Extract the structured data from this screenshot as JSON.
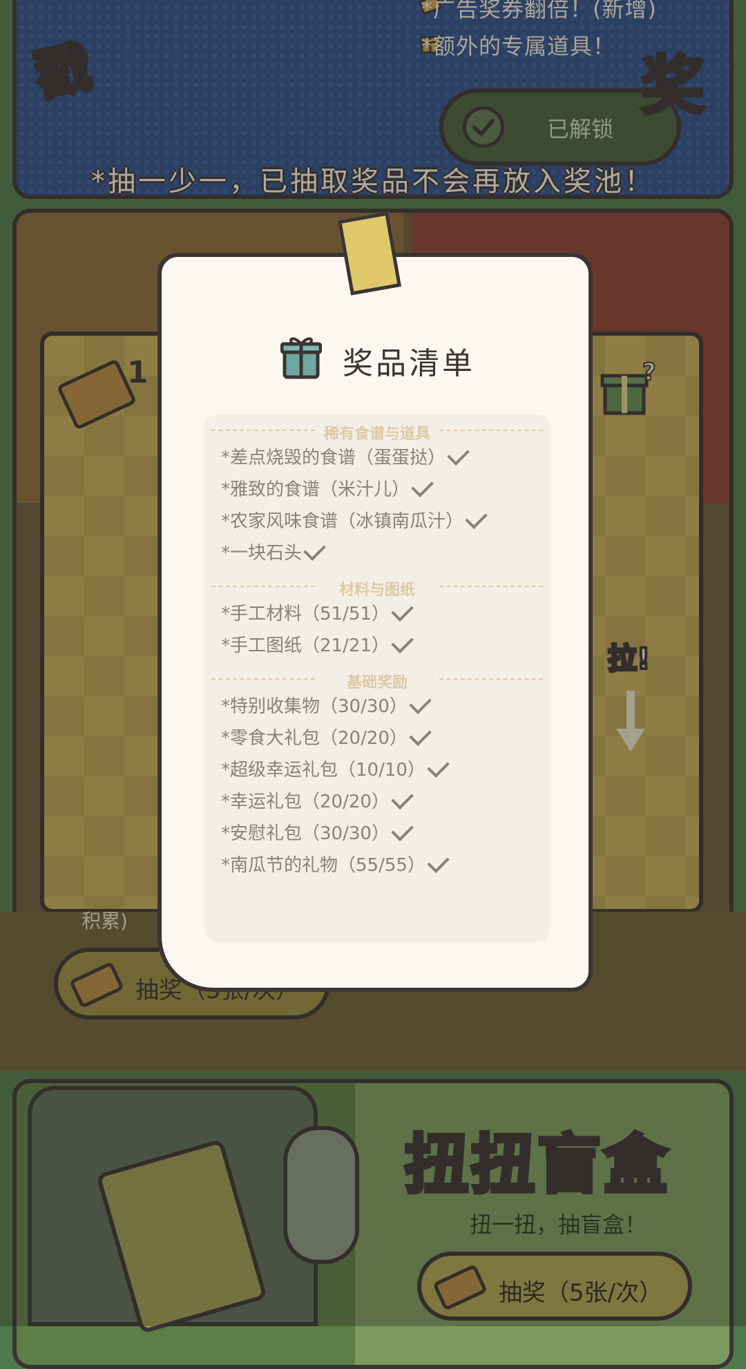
{
  "top_panel": {
    "perks": [
      "*广告奖券翻倍！(新增)",
      "*额外的专属道具！"
    ],
    "unlock_label": "已解锁",
    "draw_note": "*抽一少一，已抽取奖品不会再放入奖池！"
  },
  "middle_panel": {
    "title_left": "戳",
    "title_right": "奖",
    "ticket_count": "1",
    "pull_label": "拉!",
    "hint_text": "积累)",
    "draw_button": "抽奖（5张/次）"
  },
  "bottom_panel": {
    "title": "扭扭盲盒",
    "subtitle": "扭一扭，抽盲盒！",
    "draw_button": "抽奖（5张/次）"
  },
  "modal": {
    "title": "奖品清单",
    "sections": [
      {
        "name": "稀有食谱与道具",
        "items": [
          "*差点烧毁的食谱（蛋蛋挞）",
          "*雅致的食谱（米汁儿）",
          "*农家风味食谱（冰镇南瓜汁）",
          "*一块石头"
        ]
      },
      {
        "name": "材料与图纸",
        "items": [
          "*手工材料（51/51）",
          "*手工图纸（21/21）"
        ]
      },
      {
        "name": "基础奖励",
        "items": [
          "*特别收集物（30/30）",
          "*零食大礼包（20/20）",
          "*超级幸运礼包（10/10）",
          "*幸运礼包（20/20）",
          "*安慰礼包（30/30）",
          "*南瓜节的礼物（55/55）"
        ]
      }
    ]
  },
  "colors": {
    "outline": "#3a3434",
    "paper": "#fbf8f1",
    "list_text": "#8a817a",
    "section_header": "#dcc9a5"
  }
}
